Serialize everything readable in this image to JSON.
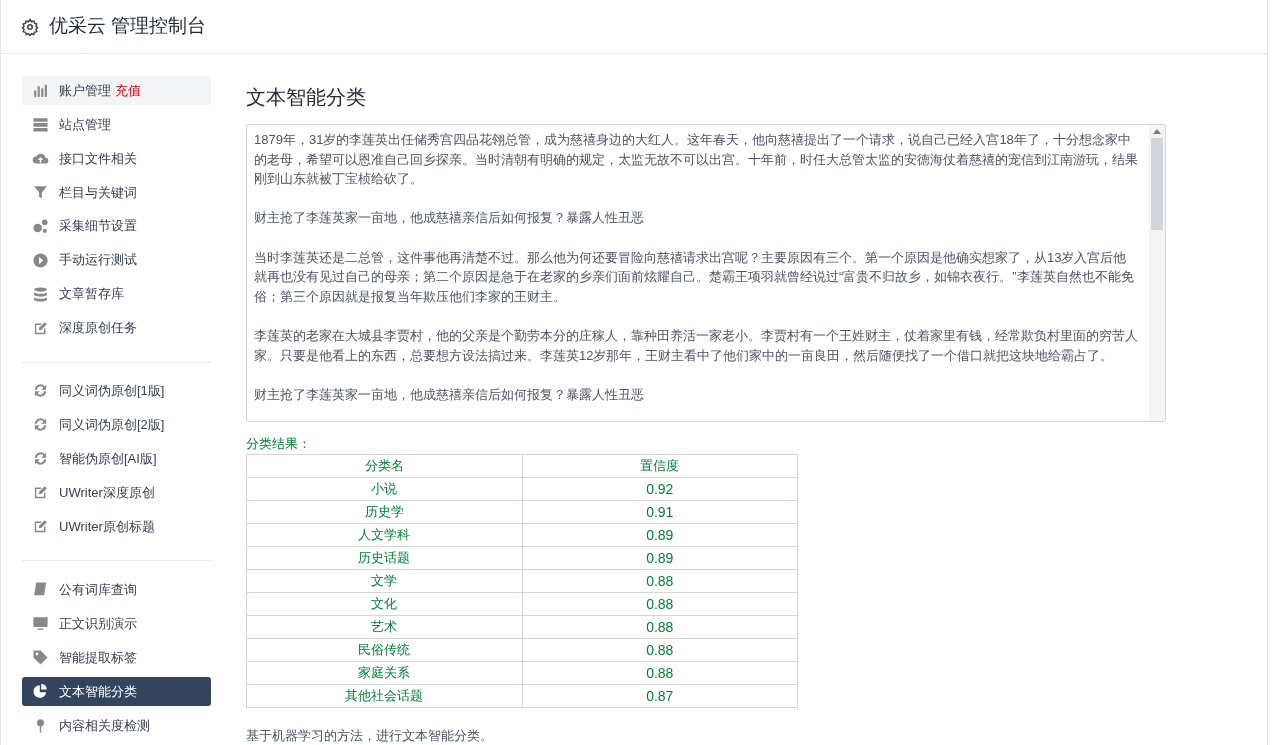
{
  "header": {
    "title": "优采云 管理控制台"
  },
  "sidebar": {
    "groups": [
      [
        {
          "label": "账户管理",
          "badge": "充值",
          "selected": false,
          "highlighted": true
        },
        {
          "label": "站点管理",
          "selected": false
        },
        {
          "label": "接口文件相关",
          "selected": false
        },
        {
          "label": "栏目与关键词",
          "selected": false
        },
        {
          "label": "采集细节设置",
          "selected": false
        },
        {
          "label": "手动运行测试",
          "selected": false
        },
        {
          "label": "文章暂存库",
          "selected": false
        },
        {
          "label": "深度原创任务",
          "selected": false
        }
      ],
      [
        {
          "label": "同义词伪原创[1版]",
          "selected": false
        },
        {
          "label": "同义词伪原创[2版]",
          "selected": false
        },
        {
          "label": "智能伪原创[AI版]",
          "selected": false
        },
        {
          "label": "UWriter深度原创",
          "selected": false
        },
        {
          "label": "UWriter原创标题",
          "selected": false
        }
      ],
      [
        {
          "label": "公有词库查询",
          "selected": false
        },
        {
          "label": "正文识别演示",
          "selected": false
        },
        {
          "label": "智能提取标签",
          "selected": false
        },
        {
          "label": "文本智能分类",
          "selected": true
        },
        {
          "label": "内容相关度检测",
          "selected": false
        }
      ]
    ]
  },
  "main": {
    "title": "文本智能分类",
    "article": {
      "paragraphs": [
        "1879年，31岁的李莲英出任储秀宫四品花翎总管，成为慈禧身边的大红人。这年春天，他向慈禧提出了一个请求，说自己已经入宫18年了，十分想念家中的老母，希望可以恩准自己回乡探亲。当时清朝有明确的规定，太监无故不可以出宫。十年前，时任大总管太监的安德海仗着慈禧的宠信到江南游玩，结果刚到山东就被丁宝桢给砍了。",
        "财主抢了李莲英家一亩地，他成慈禧亲信后如何报复？暴露人性丑恶",
        "当时李莲英还是二总管，这件事他再清楚不过。那么他为何还要冒险向慈禧请求出宫呢？主要原因有三个。第一个原因是他确实想家了，从13岁入宫后他就再也没有见过自己的母亲；第二个原因是急于在老家的乡亲们面前炫耀自己。楚霸王项羽就曾经说过“富贵不归故乡，如锦衣夜行。”李莲英自然也不能免俗；第三个原因就是报复当年欺压他们李家的王财主。",
        "李莲英的老家在大城县李贾村，他的父亲是个勤劳本分的庄稼人，靠种田养活一家老小。李贾村有一个王姓财主，仗着家里有钱，经常欺负村里面的穷苦人家。只要是他看上的东西，总要想方设法搞过来。李莲英12岁那年，王财主看中了他们家中的一亩良田，然后随便找了一个借口就把这块地给霸占了。",
        "财主抢了李莲英家一亩地，他成慈禧亲信后如何报复？暴露人性丑恶"
      ]
    },
    "result_label": "分类结果：",
    "table": {
      "columns": [
        "分类名",
        "置信度"
      ],
      "rows": [
        [
          "小说",
          "0.92"
        ],
        [
          "历史学",
          "0.91"
        ],
        [
          "人文学科",
          "0.89"
        ],
        [
          "历史话题",
          "0.89"
        ],
        [
          "文学",
          "0.88"
        ],
        [
          "文化",
          "0.88"
        ],
        [
          "艺术",
          "0.88"
        ],
        [
          "民俗传统",
          "0.88"
        ],
        [
          "家庭关系",
          "0.88"
        ],
        [
          "其他社会话题",
          "0.87"
        ]
      ]
    },
    "footnote": "基于机器学习的方法，进行文本智能分类。"
  }
}
